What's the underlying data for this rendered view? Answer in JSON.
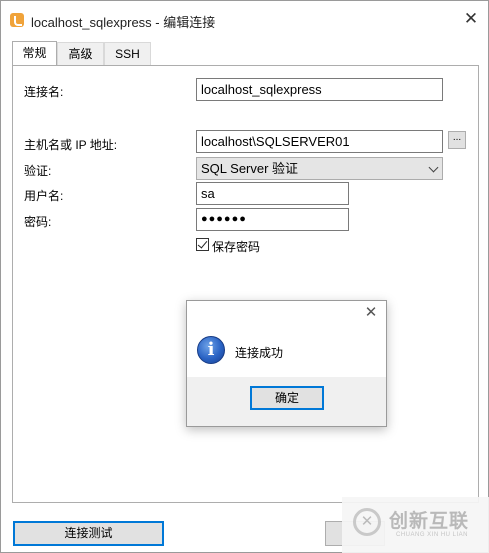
{
  "window": {
    "title": "localhost_sqlexpress - 编辑连接",
    "close_glyph": "✕"
  },
  "tabs": [
    {
      "label": "常规"
    },
    {
      "label": "高级"
    },
    {
      "label": "SSH"
    }
  ],
  "form": {
    "connection_name_label": "连接名:",
    "connection_name_value": "localhost_sqlexpress",
    "host_label": "主机名或 IP 地址:",
    "host_value": "localhost\\SQLSERVER01",
    "host_browse_label": "...",
    "auth_label": "验证:",
    "auth_value": "SQL Server 验证",
    "username_label": "用户名:",
    "username_value": "sa",
    "password_label": "密码:",
    "password_value": "●●●●●●",
    "save_password_label": "保存密码",
    "save_password_checked": true
  },
  "footer": {
    "test_connection_label": "连接测试"
  },
  "message_box": {
    "message": "连接成功",
    "ok_label": "确定",
    "close_glyph": "✕",
    "icon_glyph": "i"
  },
  "watermark": {
    "text": "创新互联",
    "sub": "CHUANG XIN HU LIAN",
    "logo_glyph": "✕"
  },
  "colors": {
    "focus_border": "#0078d7",
    "info_icon": "#2a63c4",
    "app_icon": "#f0a33a"
  }
}
